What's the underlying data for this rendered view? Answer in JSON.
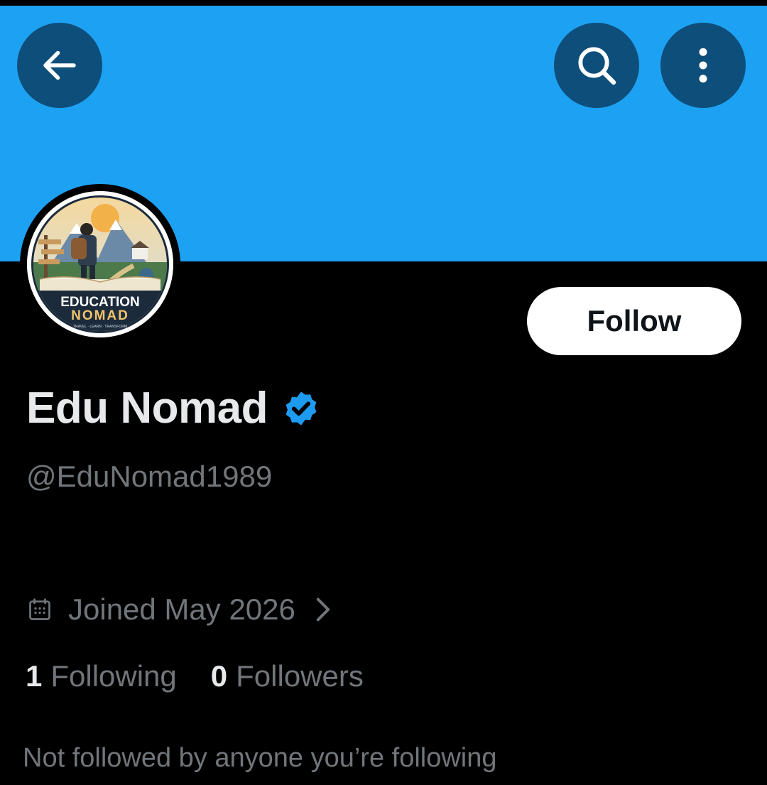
{
  "header": {
    "back_icon": "arrow-left-icon",
    "search_icon": "search-icon",
    "more_icon": "more-vertical-icon",
    "banner_color": "#1da1f2",
    "button_color": "#0e4e7a"
  },
  "avatar": {
    "line1": "EDUCATION",
    "line2": "NOMAD",
    "tagline": "TRAVEL · LEARN · TRANSFORM"
  },
  "actions": {
    "follow_label": "Follow"
  },
  "profile": {
    "display_name": "Edu Nomad",
    "verified_icon": "verified-badge-icon",
    "verified_color": "#1d9bf0",
    "handle": "@EduNomad1989",
    "joined": "Joined May 2026",
    "following_count": "1",
    "following_label": "Following",
    "followers_count": "0",
    "followers_label": "Followers",
    "mutuals_text": "Not followed by anyone you’re following"
  }
}
